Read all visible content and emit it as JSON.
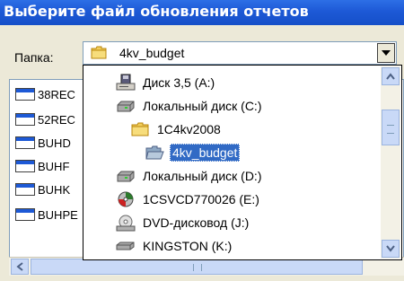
{
  "window": {
    "title": "Выберите файл обновления отчетов"
  },
  "folder": {
    "label": "Папка:",
    "value": "4kv_budget",
    "icon": "folder-icon"
  },
  "file_list": {
    "items": [
      "38REC",
      "52REC",
      "BUHD",
      "BUHF",
      "BUHK",
      "BUHPE"
    ]
  },
  "dropdown": {
    "items": [
      {
        "label": "Диск 3,5 (A:)",
        "icon": "floppy-drive-icon"
      },
      {
        "label": "Локальный диск (C:)",
        "icon": "hard-drive-icon"
      },
      {
        "label": "1C4kv2008",
        "icon": "folder-icon"
      },
      {
        "label": "4kv_budget",
        "icon": "folder-open-icon",
        "selected": true
      },
      {
        "label": "Локальный диск (D:)",
        "icon": "hard-drive-icon"
      },
      {
        "label": "1CSVCD770026 (E:)",
        "icon": "cd-drive-icon"
      },
      {
        "label": "DVD-дисковод (J:)",
        "icon": "dvd-drive-icon"
      },
      {
        "label": "KINGSTON (K:)",
        "icon": "removable-drive-icon"
      }
    ]
  },
  "colors": {
    "titlebar": "#1d59d6",
    "selection": "#316ac5",
    "dialog": "#ece9d8"
  }
}
